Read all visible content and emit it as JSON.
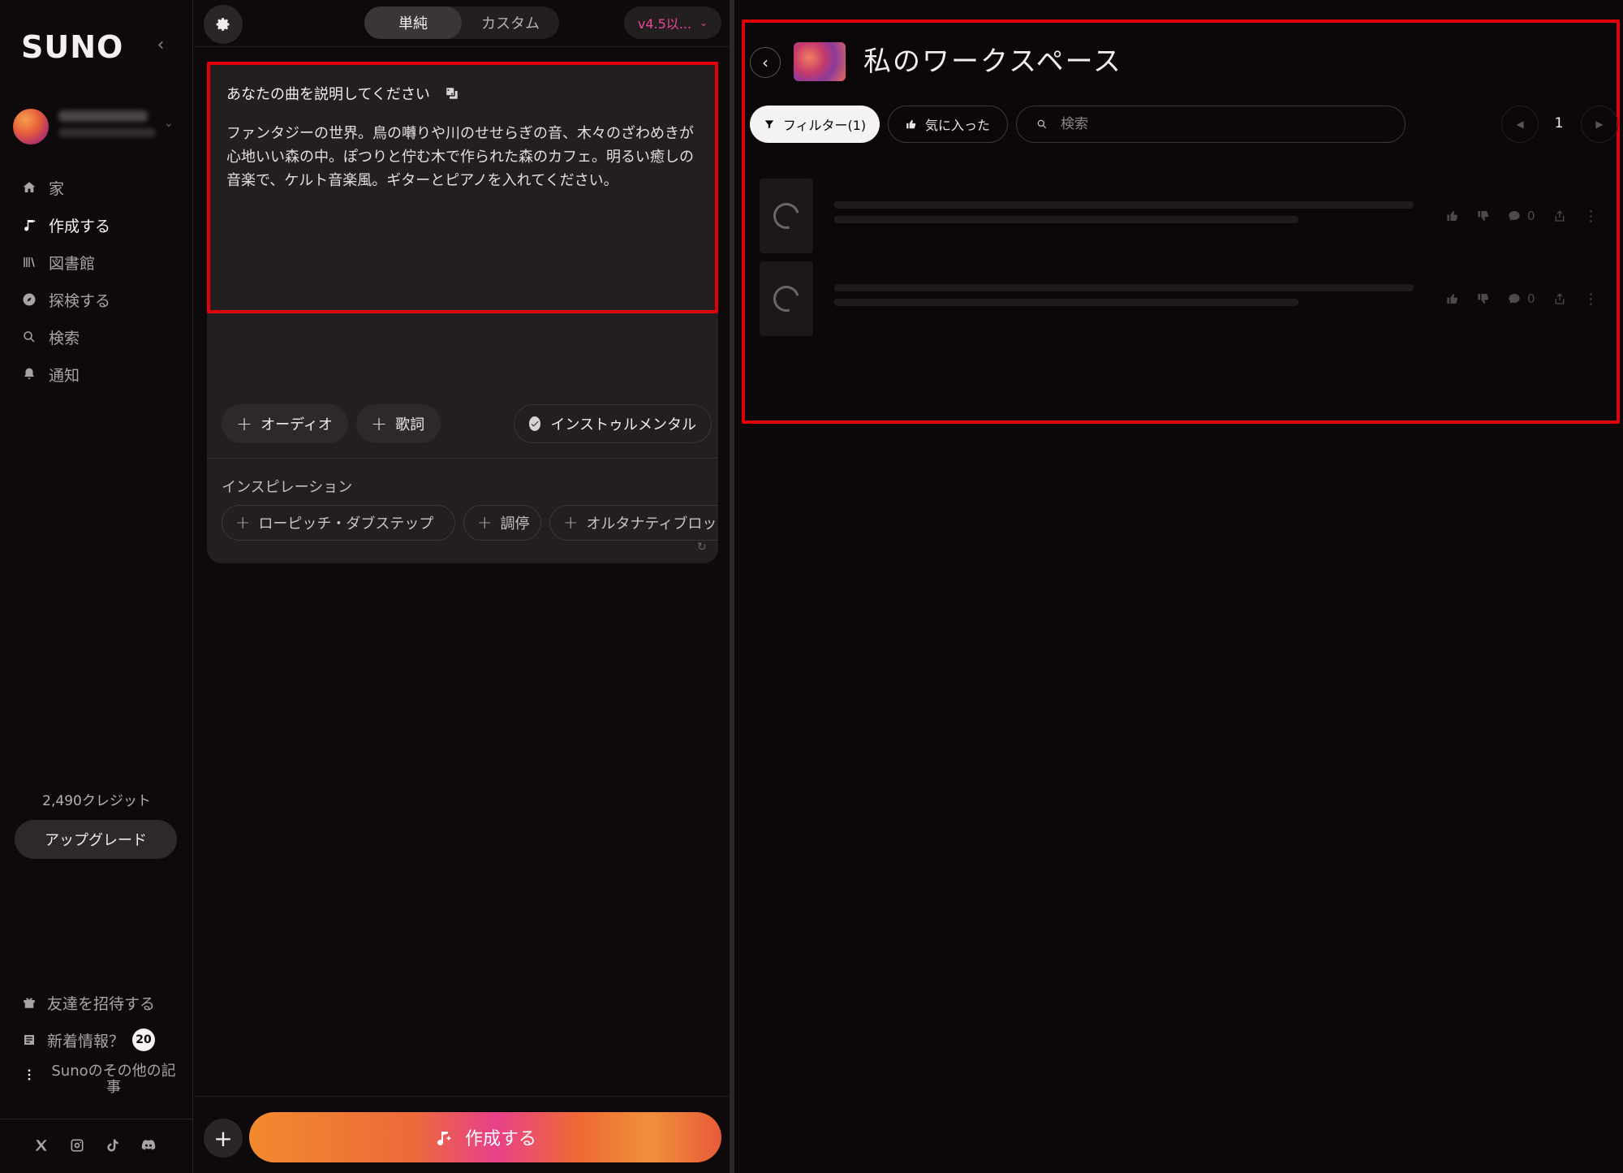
{
  "sidebar": {
    "logo": "SUNO",
    "nav": [
      {
        "label": "家",
        "icon": "home-icon"
      },
      {
        "label": "作成する",
        "icon": "music-note-icon",
        "active": true
      },
      {
        "label": "図書館",
        "icon": "library-icon"
      },
      {
        "label": "探検する",
        "icon": "compass-icon"
      },
      {
        "label": "検索",
        "icon": "search-icon"
      },
      {
        "label": "通知",
        "icon": "bell-icon"
      }
    ],
    "credits": "2,490クレジット",
    "upgrade_label": "アップグレード",
    "bottom": {
      "invite_label": "友達を招待する",
      "whats_new_label": "新着情報？",
      "whats_new_badge": "20",
      "more_label": "Sunoのその他の記事"
    },
    "socials": [
      "x-icon",
      "instagram-icon",
      "tiktok-icon",
      "discord-icon"
    ]
  },
  "create": {
    "mode_options": [
      "単純",
      "カスタム"
    ],
    "mode_selected": "単純",
    "version": "v4.5以...",
    "prompt": {
      "title": "あなたの曲を説明してください",
      "text": "ファンタジーの世界。鳥の囀りや川のせせらぎの音、木々のざわめきが心地いい森の中。ぽつりと佇む木で作られた森のカフェ。明るい癒しの音楽で、ケルト音楽風。ギターとピアノを入れてください。"
    },
    "chips": {
      "audio": "オーディオ",
      "lyrics": "歌詞",
      "instrumental": "インストゥルメンタル"
    },
    "inspiration": {
      "title": "インスピレーション",
      "items": [
        "ローピッチ・ダブステップ",
        "調停",
        "オルタナティブロッ"
      ]
    },
    "create_label": "作成する"
  },
  "workspace": {
    "title": "私のワークスペース",
    "filter_label": "フィルター(1)",
    "liked_label": "気に入った",
    "search_placeholder": "検索",
    "page": "1",
    "rows": [
      {
        "comments": "0"
      },
      {
        "comments": "0"
      }
    ]
  },
  "colors": {
    "accent_pink": "#e8489c",
    "highlight_red": "#e0000a",
    "create_gradient_start": "#f28a2e",
    "create_gradient_mid": "#e8408a"
  }
}
